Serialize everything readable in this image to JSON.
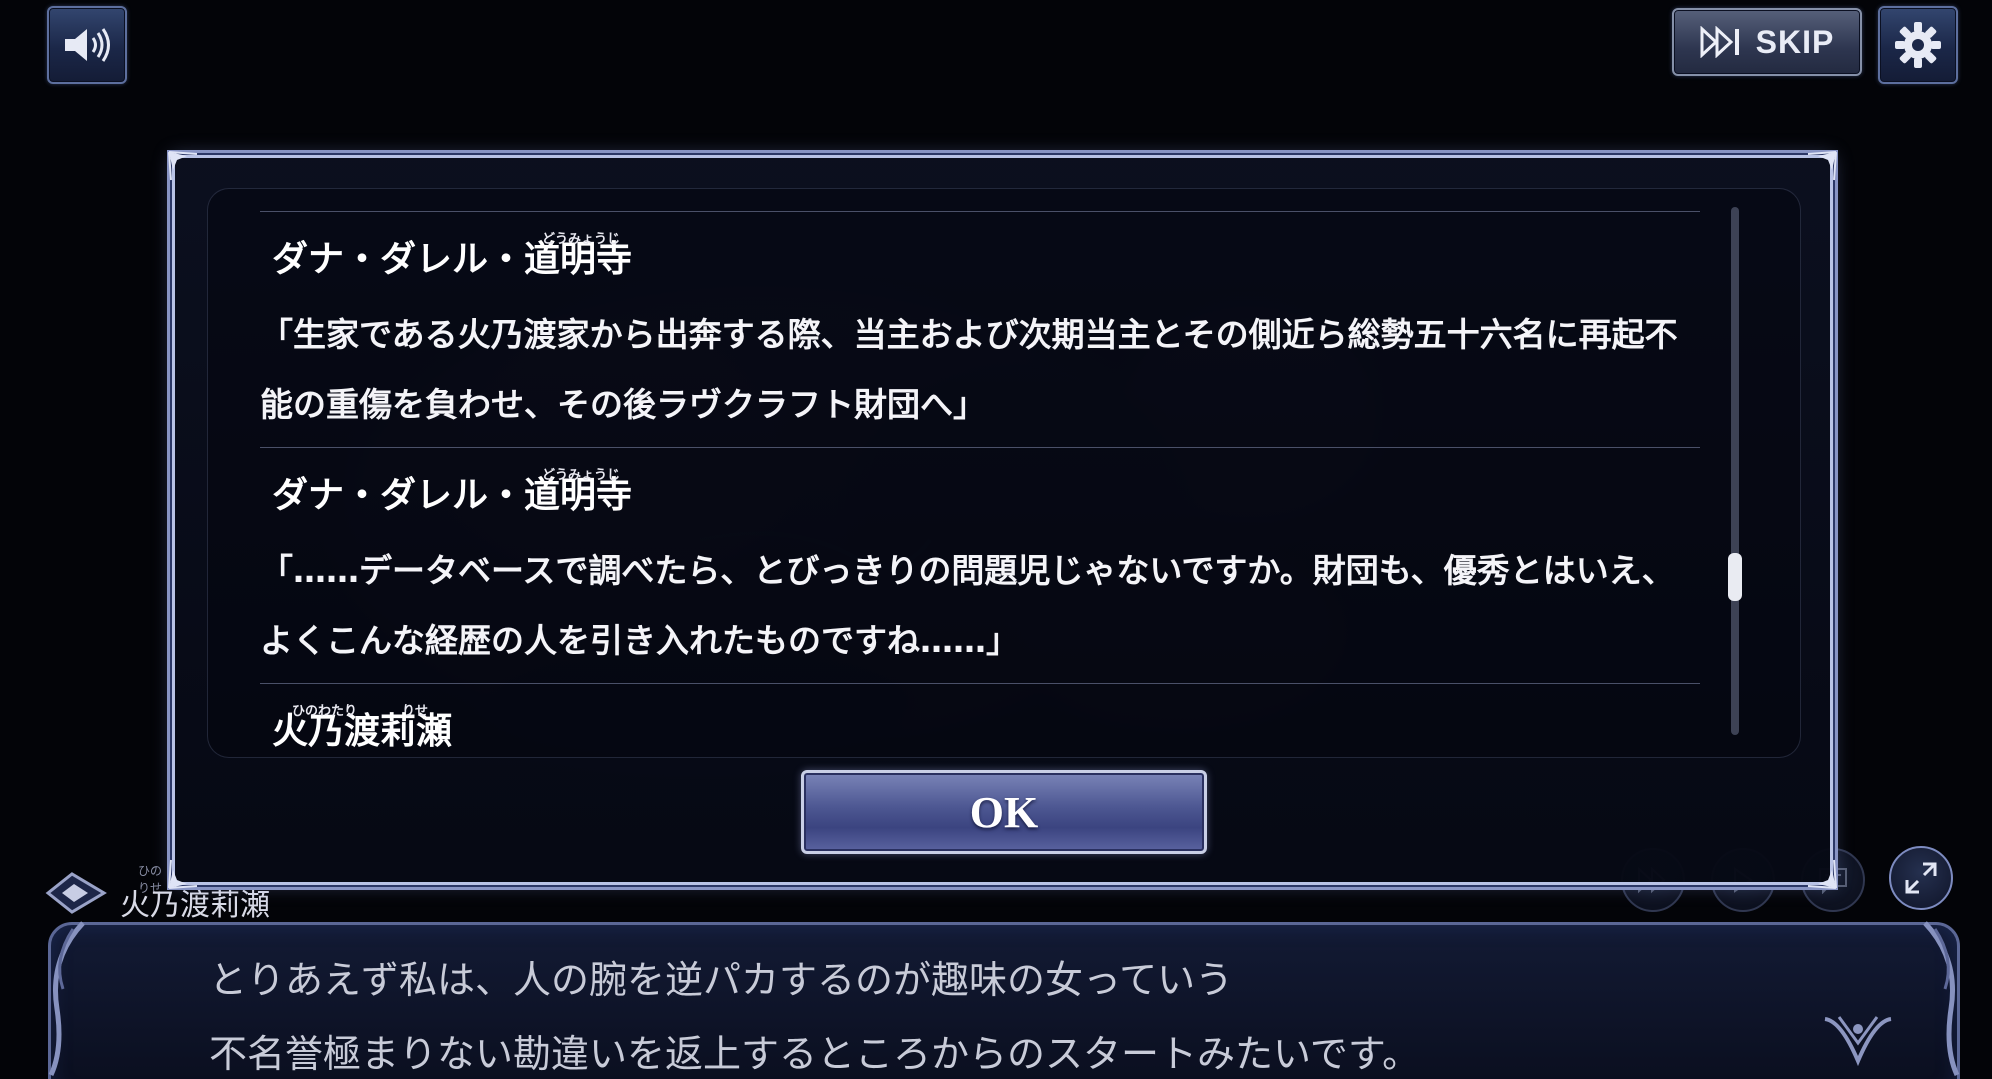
{
  "toolbar": {
    "volume_icon": "speaker-volume-icon",
    "skip_label": "SKIP",
    "skip_icon": "fast-forward-icon",
    "settings_icon": "gear-icon"
  },
  "backlog": {
    "entries": [
      {
        "speaker": "ダナ・ダレル・道明寺",
        "ruby": "どうみょうじ",
        "text": "「生家である火乃渡家から出奔する際、当主および次期当主とその側近ら総勢五十六名に再起不能の重傷を負わせ、その後ラヴクラフト財団へ」"
      },
      {
        "speaker": "ダナ・ダレル・道明寺",
        "ruby": "どうみょうじ",
        "text": "「……データベースで調べたら、とびっきりの問題児じゃないですか。財団も、優秀とはいえ、よくこんな経歴の人を引き入れたものですね……」"
      },
      {
        "speaker": "火乃渡莉瀬",
        "ruby_a": "ひのわたり",
        "ruby_b": "りせ",
        "text": ""
      }
    ],
    "ok_label": "OK",
    "scroll_position": 0.72
  },
  "controls": {
    "auto_icon": "auto-play-icon",
    "next_icon": "play-icon",
    "log_icon": "message-icon",
    "fullscreen_icon": "expand-icon"
  },
  "dialogue": {
    "speaker": "火乃渡莉瀬",
    "speaker_ruby": "ひの　　　りせ",
    "line1": "とりあえず私は、人の腕を逆パカするのが趣味の女っていう",
    "line2": "不名誉極まりない勘違いを返上するところからのスタートみたいです。"
  },
  "colors": {
    "frame": "#b9c3e6",
    "button_blue": "#4c5691",
    "accent": "#5b6796"
  }
}
